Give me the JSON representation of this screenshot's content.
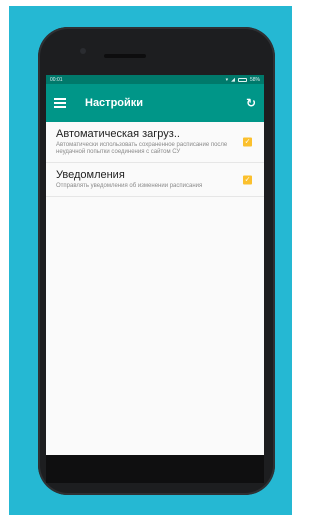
{
  "status_bar": {
    "time": "00:01",
    "battery": "58%"
  },
  "toolbar": {
    "title": "Настройки",
    "menu_icon": "menu-icon",
    "refresh_icon": "refresh-icon"
  },
  "preferences": [
    {
      "title": "Автоматическая загруз..",
      "summary": "Автоматически использовать сохраненное расписание после неудачной попытки соединения с сайтом СУ",
      "checked": true
    },
    {
      "title": "Уведомления",
      "summary": "Отправлять уведомления об изменении расписания",
      "checked": true
    }
  ],
  "colors": {
    "accent": "#009688",
    "status": "#00796b",
    "checkbox": "#fbc02d",
    "background": "#25b8d3"
  }
}
